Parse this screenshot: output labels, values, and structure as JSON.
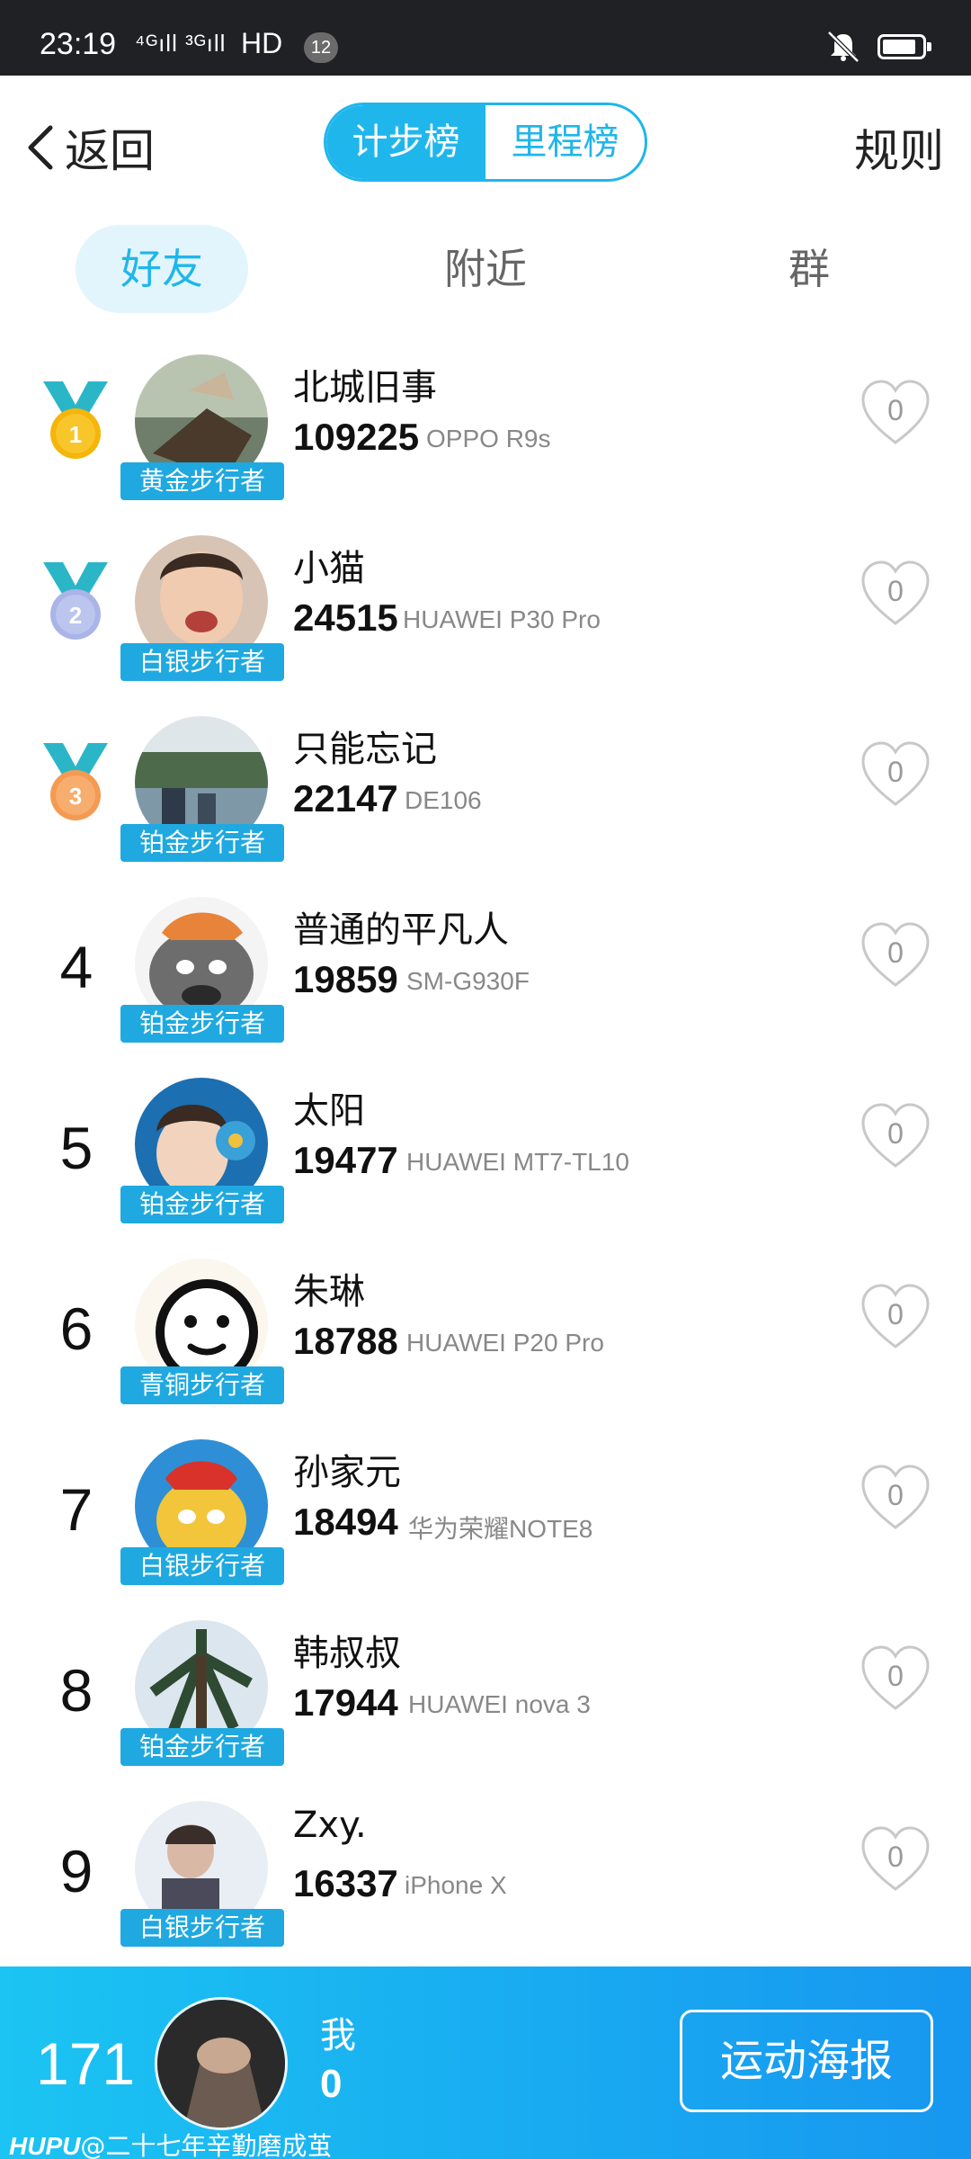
{
  "status_bar": {
    "time": "23:19",
    "signal": "⁴ᴳıll ³ᴳıll",
    "hd": "HD",
    "notification_count": "12"
  },
  "header": {
    "back_label": "返回",
    "segments": [
      "计步榜",
      "里程榜"
    ],
    "rules_label": "规则"
  },
  "tabs": [
    "好友",
    "附近",
    "群"
  ],
  "entries": [
    {
      "rank": "1",
      "name": "北城旧事",
      "steps": "109225",
      "device": "OPPO R9s",
      "badge": "黄金步行者",
      "likes": "0"
    },
    {
      "rank": "2",
      "name": "小猫",
      "steps": "24515",
      "device": "HUAWEI P30 Pro",
      "badge": "白银步行者",
      "likes": "0"
    },
    {
      "rank": "3",
      "name": "只能忘记",
      "steps": "22147",
      "device": "DE106",
      "badge": "铂金步行者",
      "likes": "0"
    },
    {
      "rank": "4",
      "name": "普通的平凡人",
      "steps": "19859",
      "device": "SM-G930F",
      "badge": "铂金步行者",
      "likes": "0"
    },
    {
      "rank": "5",
      "name": "太阳",
      "steps": "19477",
      "device": "HUAWEI MT7-TL10",
      "badge": "铂金步行者",
      "likes": "0"
    },
    {
      "rank": "6",
      "name": "朱琳",
      "steps": "18788",
      "device": "HUAWEI P20 Pro",
      "badge": "青铜步行者",
      "likes": "0"
    },
    {
      "rank": "7",
      "name": "孙家元",
      "steps": "18494",
      "device": "华为荣耀NOTE8",
      "badge": "白银步行者",
      "likes": "0"
    },
    {
      "rank": "8",
      "name": "韩叔叔",
      "steps": "17944",
      "device": "HUAWEI nova 3",
      "badge": "铂金步行者",
      "likes": "0"
    },
    {
      "rank": "9",
      "name": "Zxy.",
      "steps": "16337",
      "device": "iPhone X",
      "badge": "白银步行者",
      "likes": "0"
    }
  ],
  "me": {
    "rank": "171",
    "label": "我",
    "steps": "0",
    "poster_button": "运动海报"
  },
  "watermark": {
    "brand": "HUPU",
    "handle": "@二十七年辛勤磨成茧"
  },
  "colors": {
    "accent": "#1fb6ec",
    "badge": "#1fa9e0",
    "medal_gold": "#f5b50a",
    "medal_silver": "#aab4e6",
    "medal_bronze": "#f49a52"
  }
}
